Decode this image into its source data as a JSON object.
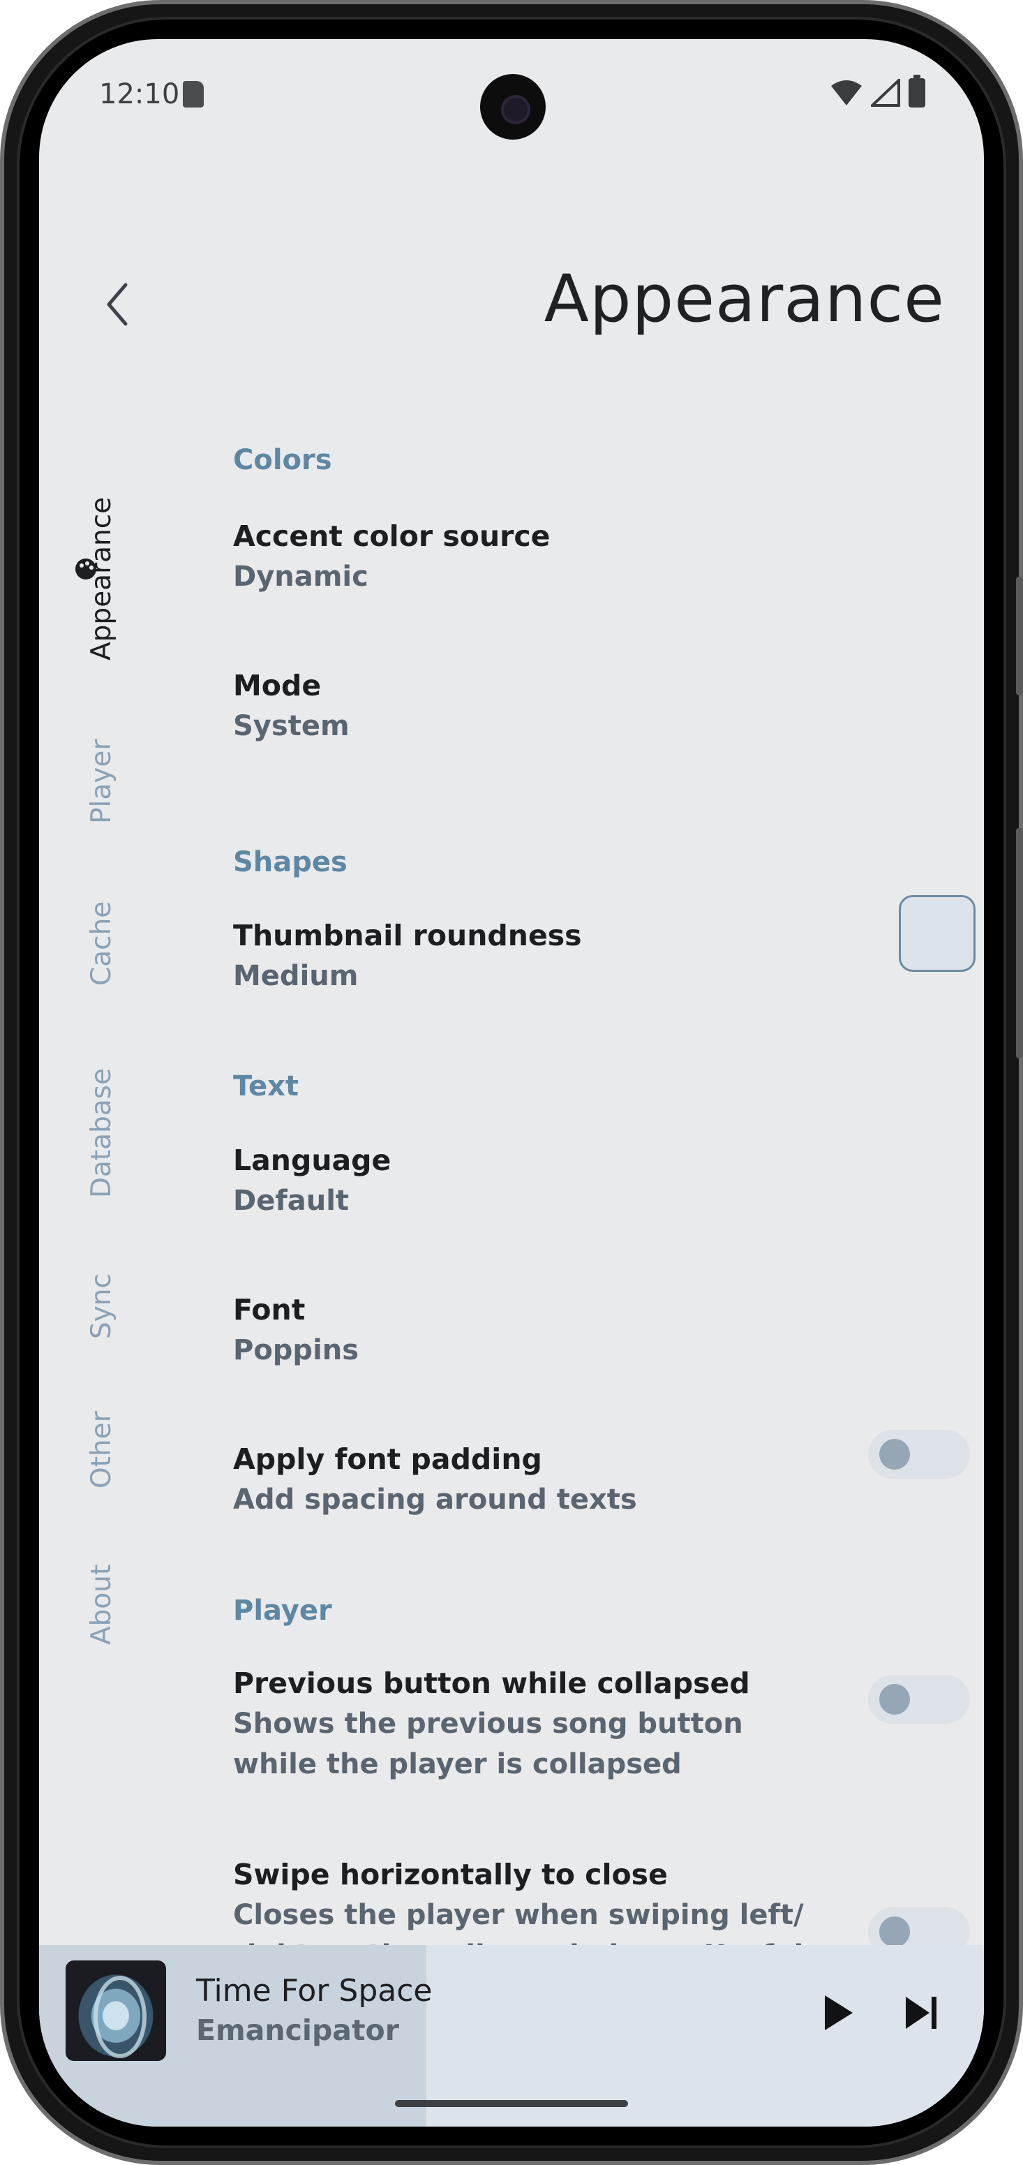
{
  "status_bar": {
    "time": "12:10",
    "icons": [
      "sd-card-icon",
      "wifi-icon",
      "signal-icon",
      "battery-icon"
    ]
  },
  "header": {
    "title": "Appearance",
    "back_icon": "chevron-left-icon"
  },
  "rail": {
    "items": [
      {
        "label": "Appearance",
        "active": true,
        "icon": "palette-icon"
      },
      {
        "label": "Player",
        "active": false
      },
      {
        "label": "Cache",
        "active": false
      },
      {
        "label": "Database",
        "active": false
      },
      {
        "label": "Sync",
        "active": false
      },
      {
        "label": "Other",
        "active": false
      },
      {
        "label": "About",
        "active": false
      }
    ]
  },
  "sections": {
    "colors": "Colors",
    "shapes": "Shapes",
    "text": "Text",
    "player": "Player"
  },
  "settings": {
    "accent": {
      "title": "Accent color source",
      "value": "Dynamic"
    },
    "mode": {
      "title": "Mode",
      "value": "System"
    },
    "thumbnail": {
      "title": "Thumbnail roundness",
      "value": "Medium"
    },
    "language": {
      "title": "Language",
      "value": "Default"
    },
    "font": {
      "title": "Font",
      "value": "Poppins"
    },
    "font_padding": {
      "title": "Apply font padding",
      "subtitle": "Add spacing around texts",
      "enabled": false
    },
    "previous_button": {
      "title": "Previous button while collapsed",
      "subtitle": "Shows the previous song button while the player is collapsed",
      "enabled": false
    },
    "swipe_close": {
      "title": "Swipe horizontally to close",
      "subtitle": "Closes the player when swiping left/ right on the collapsed player. Useful",
      "enabled": false
    }
  },
  "mini_player": {
    "title": "Time For Space",
    "artist": "Emancipator",
    "progress_fraction": 0.41,
    "controls": [
      "play-icon",
      "skip-next-icon"
    ]
  },
  "colors": {
    "background": "#e9eaec",
    "accent": "#5e87a4",
    "rail_inactive": "#8aa2b7",
    "mini_player": "#dde3ea"
  }
}
